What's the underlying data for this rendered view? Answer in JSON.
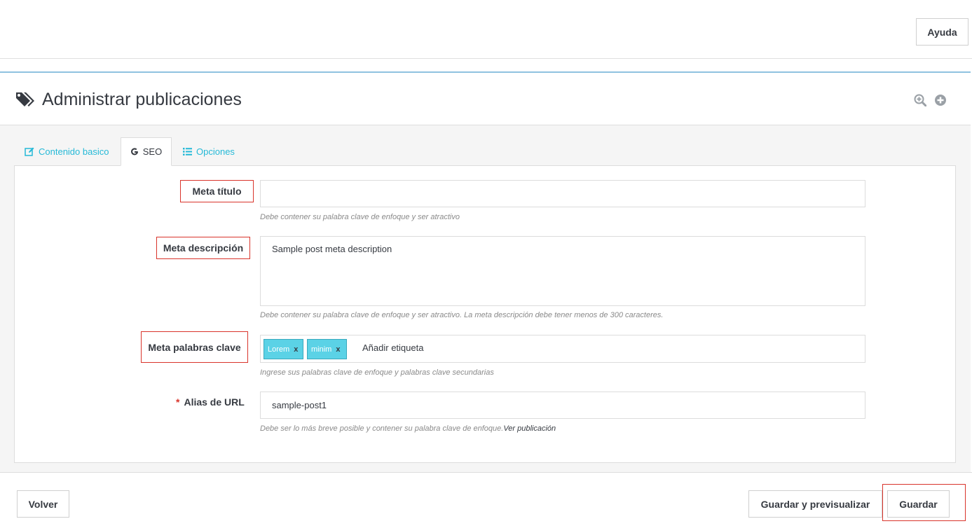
{
  "topbar": {
    "help_label": "Ayuda"
  },
  "header": {
    "title": "Administrar publicaciones",
    "icons": [
      "tag-icon",
      "zoom-in-icon",
      "plus-circle-icon"
    ]
  },
  "tabs": [
    {
      "label": "Contenido basico",
      "icon": "edit-icon",
      "active": false
    },
    {
      "label": "SEO",
      "icon": "google-icon",
      "active": true
    },
    {
      "label": "Opciones",
      "icon": "list-icon",
      "active": false
    }
  ],
  "form": {
    "meta_title": {
      "label": "Meta título",
      "value": "",
      "hint": "Debe contener su palabra clave de enfoque y ser atractivo"
    },
    "meta_description": {
      "label": "Meta descripción",
      "value": "Sample post meta description",
      "hint": "Debe contener su palabra clave de enfoque y ser atractivo. La meta descripción debe tener menos de 300 caracteres."
    },
    "meta_keywords": {
      "label": "Meta palabras clave",
      "tags": [
        "Lorem",
        "minim"
      ],
      "remove_symbol": "x",
      "placeholder": "Añadir etiqueta",
      "hint": "Ingrese sus palabras clave de enfoque y palabras clave secundarias"
    },
    "url_alias": {
      "required_mark": "*",
      "label": "Alias de URL",
      "value": "sample-post1",
      "hint": "Debe ser lo más breve posible y contener su palabra clave de enfoque.",
      "link_label": "Ver publicación"
    }
  },
  "footer": {
    "back_label": "Volver",
    "save_preview_label": "Guardar y previsualizar",
    "save_label": "Guardar"
  },
  "colors": {
    "accent": "#25b9d7",
    "tag_chip": "#5bd2e6",
    "highlight_border": "#d9342b",
    "panel_top_border": "#8fc2e0"
  }
}
